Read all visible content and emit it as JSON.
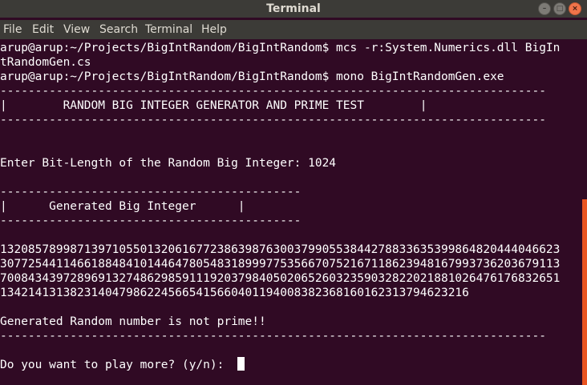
{
  "window": {
    "title": "Terminal",
    "buttons": {
      "minimize": "–",
      "maximize": "□",
      "close": "×"
    }
  },
  "menu": {
    "items": [
      "File",
      "Edit",
      "View",
      "Search",
      "Terminal",
      "Help"
    ]
  },
  "terminal": {
    "lines": [
      "arup@arup:~/Projects/BigIntRandom/BigIntRandom$ mcs -r:System.Numerics.dll BigIn",
      "tRandomGen.cs",
      "arup@arup:~/Projects/BigIntRandom/BigIntRandom$ mono BigIntRandomGen.exe",
      "------------------------------------------------------------------------------",
      "|        RANDOM BIG INTEGER GENERATOR AND PRIME TEST        |",
      "------------------------------------------------------------------------------",
      "",
      "",
      "Enter Bit-Length of the Random Big Integer: 1024",
      "",
      "-------------------------------------------",
      "|      Generated Big Integer      |",
      "-------------------------------------------",
      "",
      "13208578998713971055013206167723863987630037990553844278833635399864820444046623",
      "30772544114661884841014464780548318999775356670752167118623948167993736203679113",
      "70084343972896913274862985911192037984050206526032359032822021881026476176832651",
      "1342141313823140479862245665415660401194008382368160162313794623216",
      "",
      "Generated Random number is not prime!!",
      "------------------------------------------------------------------------------",
      "",
      "Do you want to play more? (y/n): "
    ]
  },
  "colors": {
    "terminal_bg": "#300a24",
    "chrome_bg": "#3c3b37",
    "text": "#ffffff",
    "accent": "#e95420"
  }
}
